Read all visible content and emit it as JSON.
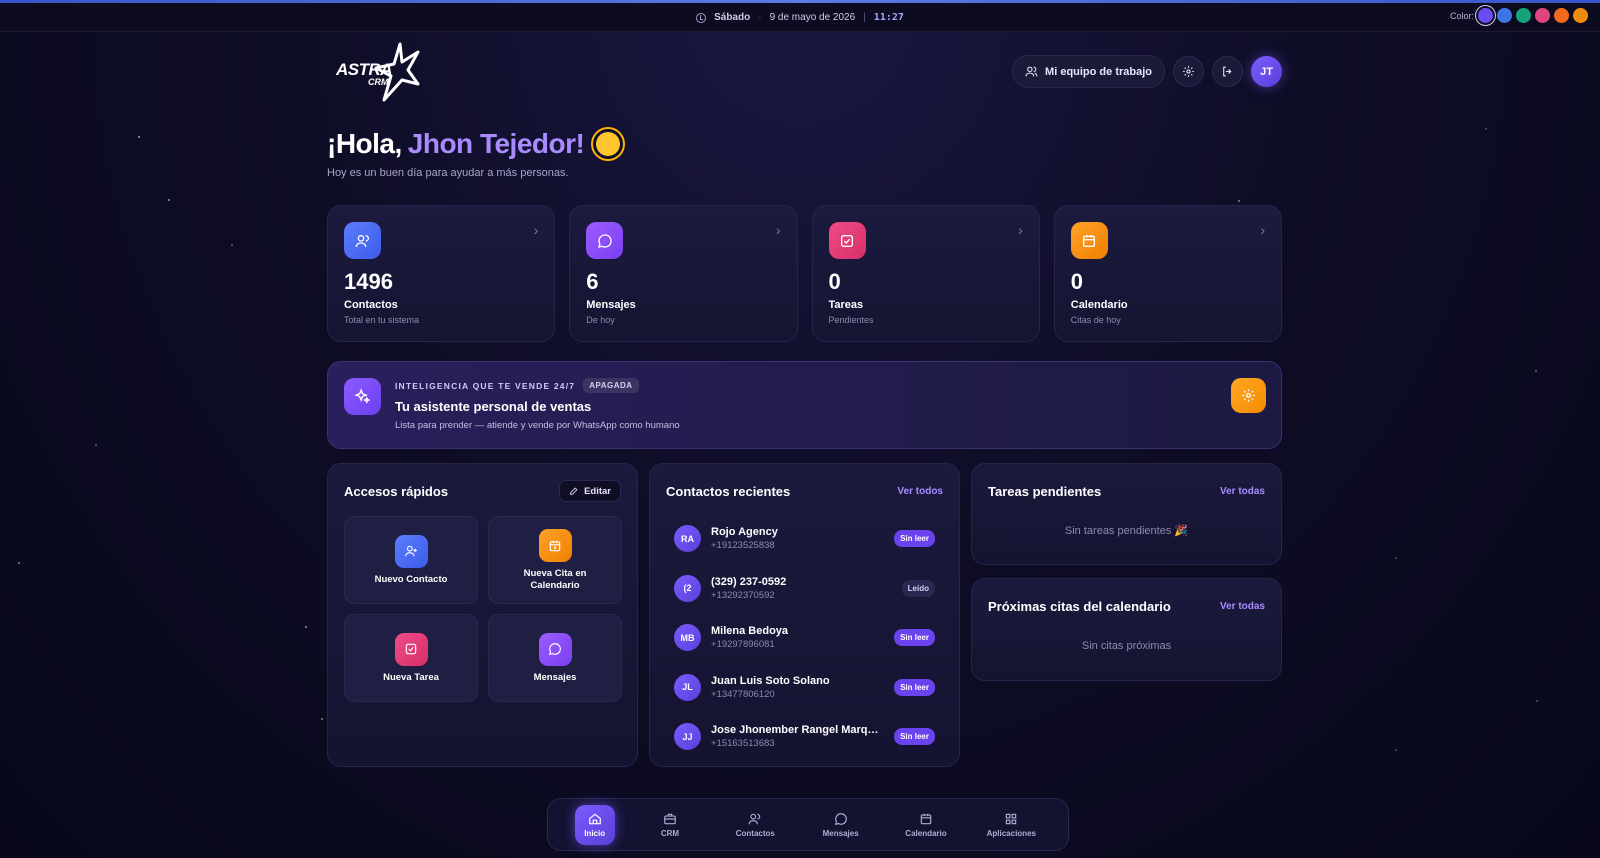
{
  "topbar": {
    "day": "Sábado",
    "separator": "·",
    "date": "9 de mayo de 2026",
    "divider": "|",
    "time": "11:27",
    "color_label": "Color:",
    "swatches": [
      "#6a4cf0",
      "#3d74e6",
      "#16a37a",
      "#e0457f",
      "#f26b1d",
      "#f08c0c"
    ]
  },
  "logo": {
    "primary": "ASTRA",
    "secondary": "CRM"
  },
  "header": {
    "team_button": "Mi equipo de trabajo",
    "avatar_initials": "JT"
  },
  "greeting": {
    "hello": "¡Hola,",
    "name": "Jhon Tejedor!",
    "subtitle": "Hoy es un buen día para ayudar a más personas."
  },
  "stats": [
    {
      "value": "1496",
      "label": "Contactos",
      "sub": "Total en tu sistema",
      "icon": "users-icon",
      "color": "#4a6cf7"
    },
    {
      "value": "6",
      "label": "Mensajes",
      "sub": "De hoy",
      "icon": "message-icon",
      "color": "#8a4ff3"
    },
    {
      "value": "0",
      "label": "Tareas",
      "sub": "Pendientes",
      "icon": "task-icon",
      "color": "#e63c78"
    },
    {
      "value": "0",
      "label": "Calendario",
      "sub": "Citas de hoy",
      "icon": "calendar-icon",
      "color": "#f58b0b"
    }
  ],
  "ai_banner": {
    "kicker": "INTELIGENCIA QUE TE VENDE 24/7",
    "status": "APAGADA",
    "title": "Tu asistente personal de ventas",
    "description": "Lista para prender — atiende y vende por WhatsApp como humano"
  },
  "quick_access": {
    "title": "Accesos rápidos",
    "edit_label": "Editar",
    "items": [
      {
        "label": "Nuevo Contacto",
        "icon": "user-plus-icon",
        "color": "#4a6cf7"
      },
      {
        "label": "Nueva Cita en Calendario",
        "icon": "calendar-plus-icon",
        "color": "#f58b0b"
      },
      {
        "label": "Nueva Tarea",
        "icon": "task-icon",
        "color": "#e63c78"
      },
      {
        "label": "Mensajes",
        "icon": "message-icon",
        "color": "#8a4ff3"
      }
    ]
  },
  "recent_contacts": {
    "title": "Contactos recientes",
    "link": "Ver todos",
    "items": [
      {
        "initials": "RA",
        "name": "Rojo Agency",
        "phone": "+19123525838",
        "status": "Sin leer"
      },
      {
        "initials": "(2",
        "name": "(329) 237-0592",
        "phone": "+13292370592",
        "status": "Leído"
      },
      {
        "initials": "MB",
        "name": "Milena Bedoya",
        "phone": "+19297896081",
        "status": "Sin leer"
      },
      {
        "initials": "JL",
        "name": "Juan Luis Soto Solano",
        "phone": "+13477806120",
        "status": "Sin leer"
      },
      {
        "initials": "JJ",
        "name": "Jose Jhonember Rangel Marqui...",
        "phone": "+15163513683",
        "status": "Sin leer"
      }
    ]
  },
  "tasks": {
    "title": "Tareas pendientes",
    "link": "Ver todas",
    "empty": "Sin tareas pendientes 🎉"
  },
  "appointments": {
    "title": "Próximas citas del calendario",
    "link": "Ver todas",
    "empty": "Sin citas próximas"
  },
  "nav": [
    {
      "label": "Inicio",
      "icon": "home-icon",
      "active": true
    },
    {
      "label": "CRM",
      "icon": "briefcase-icon",
      "active": false
    },
    {
      "label": "Contactos",
      "icon": "users-icon",
      "active": false
    },
    {
      "label": "Mensajes",
      "icon": "message-icon",
      "active": false
    },
    {
      "label": "Calendario",
      "icon": "calendar-icon",
      "active": false
    },
    {
      "label": "Aplicaciones",
      "icon": "grid-icon",
      "active": false
    }
  ]
}
